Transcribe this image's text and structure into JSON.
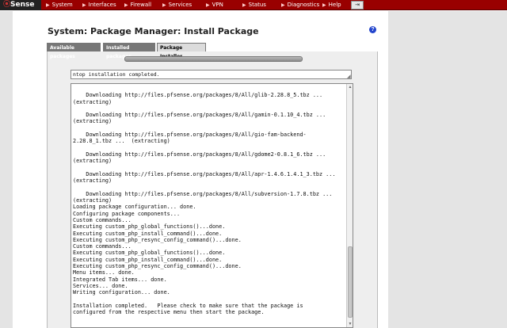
{
  "brand": {
    "logo_mark": "⦿",
    "logo_text": "Sense"
  },
  "menu": {
    "items": [
      "System",
      "Interfaces",
      "Firewall",
      "Services",
      "VPN",
      "Status",
      "Diagnostics",
      "Help"
    ],
    "extra_icon": "exit-icon"
  },
  "page": {
    "title": "System: Package Manager: Install Package",
    "help_glyph": "?"
  },
  "tabs": {
    "available": "Available packages",
    "installed": "Installed packages",
    "installer": "Package Installer",
    "active": "installer"
  },
  "installer": {
    "status": "ntop installation completed.",
    "output": "\n    Downloading http://files.pfsense.org/packages/8/All/glib-2.28.8_5.tbz ...\n(extracting)\n\n    Downloading http://files.pfsense.org/packages/8/All/gamin-0.1.10_4.tbz ...\n(extracting)\n\n    Downloading http://files.pfsense.org/packages/8/All/gio-fam-backend-\n2.28.8_1.tbz ...  (extracting)\n\n    Downloading http://files.pfsense.org/packages/8/All/gdome2-0.8.1_6.tbz ...\n(extracting)\n\n    Downloading http://files.pfsense.org/packages/8/All/apr-1.4.6.1.4.1_3.tbz ...\n(extracting)\n\n    Downloading http://files.pfsense.org/packages/8/All/subversion-1.7.8.tbz ...\n(extracting)\nLoading package configuration... done.\nConfiguring package components...\nCustom commands...\nExecuting custom_php_global_functions()...done.\nExecuting custom_php_install_command()...done.\nExecuting custom_php_resync_config_command()...done.\nCustom commands...\nExecuting custom_php_global_functions()...done.\nExecuting custom_php_install_command()...done.\nExecuting custom_php_resync_config_command()...done.\nMenu items... done.\nIntegrated Tab items... done.\nServices... done.\nWriting configuration... done.\n\nInstallation completed.   Please check to make sure that the package is\nconfigured from the respective menu then start the package."
  },
  "colors": {
    "menubar": "#990000",
    "sidebars": "#e4e4e4",
    "tab_inactive": "#777777",
    "tab_active": "#dcdcdc",
    "help_icon": "#2244cc"
  }
}
